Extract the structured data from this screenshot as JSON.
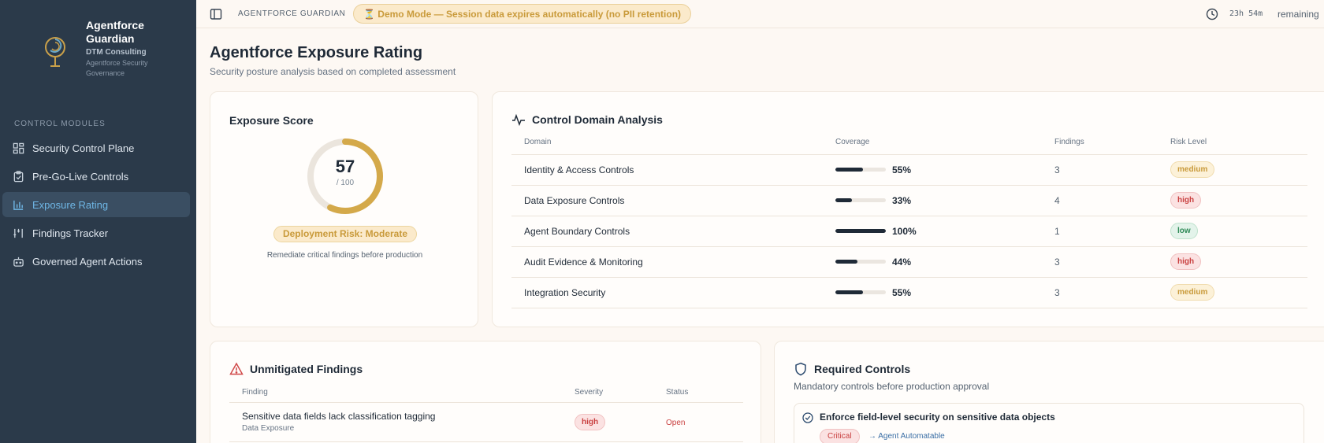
{
  "sidebar": {
    "brand_title": "Agentforce Guardian",
    "brand_company": "DTM Consulting",
    "brand_tagline": "Agentforce Security Governance",
    "section_label": "CONTROL MODULES",
    "items": [
      {
        "label": "Security Control Plane",
        "icon": "dashboard-icon",
        "active": false
      },
      {
        "label": "Pre-Go-Live Controls",
        "icon": "clipboard-check-icon",
        "active": false
      },
      {
        "label": "Exposure Rating",
        "icon": "bar-chart-icon",
        "active": true
      },
      {
        "label": "Findings Tracker",
        "icon": "tracker-icon",
        "active": false
      },
      {
        "label": "Governed Agent Actions",
        "icon": "bot-icon",
        "active": false
      }
    ]
  },
  "topbar": {
    "title": "AGENTFORCE GUARDIAN",
    "demo_notice": "⏳ Demo Mode — Session data expires automatically (no PII retention)",
    "timer": "23h 54m",
    "remaining": "remaining"
  },
  "header": {
    "title": "Agentforce Exposure Rating",
    "subtitle": "Security posture analysis based on completed assessment"
  },
  "score": {
    "title": "Exposure Score",
    "value": "57",
    "max": "/ 100",
    "fraction": 0.57,
    "risk_label": "Deployment Risk: Moderate",
    "note": "Remediate critical findings before production"
  },
  "domains": {
    "title": "Control Domain Analysis",
    "columns": [
      "Domain",
      "Coverage",
      "Findings",
      "Risk Level"
    ],
    "rows": [
      {
        "domain": "Identity & Access Controls",
        "coverage": "55%",
        "coverage_value": 55,
        "findings": "3",
        "risk": "medium"
      },
      {
        "domain": "Data Exposure Controls",
        "coverage": "33%",
        "coverage_value": 33,
        "findings": "4",
        "risk": "high"
      },
      {
        "domain": "Agent Boundary Controls",
        "coverage": "100%",
        "coverage_value": 100,
        "findings": "1",
        "risk": "low"
      },
      {
        "domain": "Audit Evidence & Monitoring",
        "coverage": "44%",
        "coverage_value": 44,
        "findings": "3",
        "risk": "high"
      },
      {
        "domain": "Integration Security",
        "coverage": "55%",
        "coverage_value": 55,
        "findings": "3",
        "risk": "medium"
      }
    ]
  },
  "findings": {
    "title": "Unmitigated Findings",
    "columns": [
      "Finding",
      "Severity",
      "Status"
    ],
    "rows": [
      {
        "finding": "Sensitive data fields lack classification tagging",
        "category": "Data Exposure",
        "severity": "high",
        "status": "Open"
      }
    ]
  },
  "required": {
    "title": "Required Controls",
    "subtitle": "Mandatory controls before production approval",
    "items": [
      {
        "title": "Enforce field-level security on sensitive data objects",
        "priority": "Critical",
        "tag": "→ Agent Automatable"
      }
    ]
  },
  "colors": {
    "sidebar_bg": "#2b3a4a",
    "accent_active": "#6fb7e6",
    "gauge": "#d4a94a",
    "background": "#fdf8f3"
  }
}
